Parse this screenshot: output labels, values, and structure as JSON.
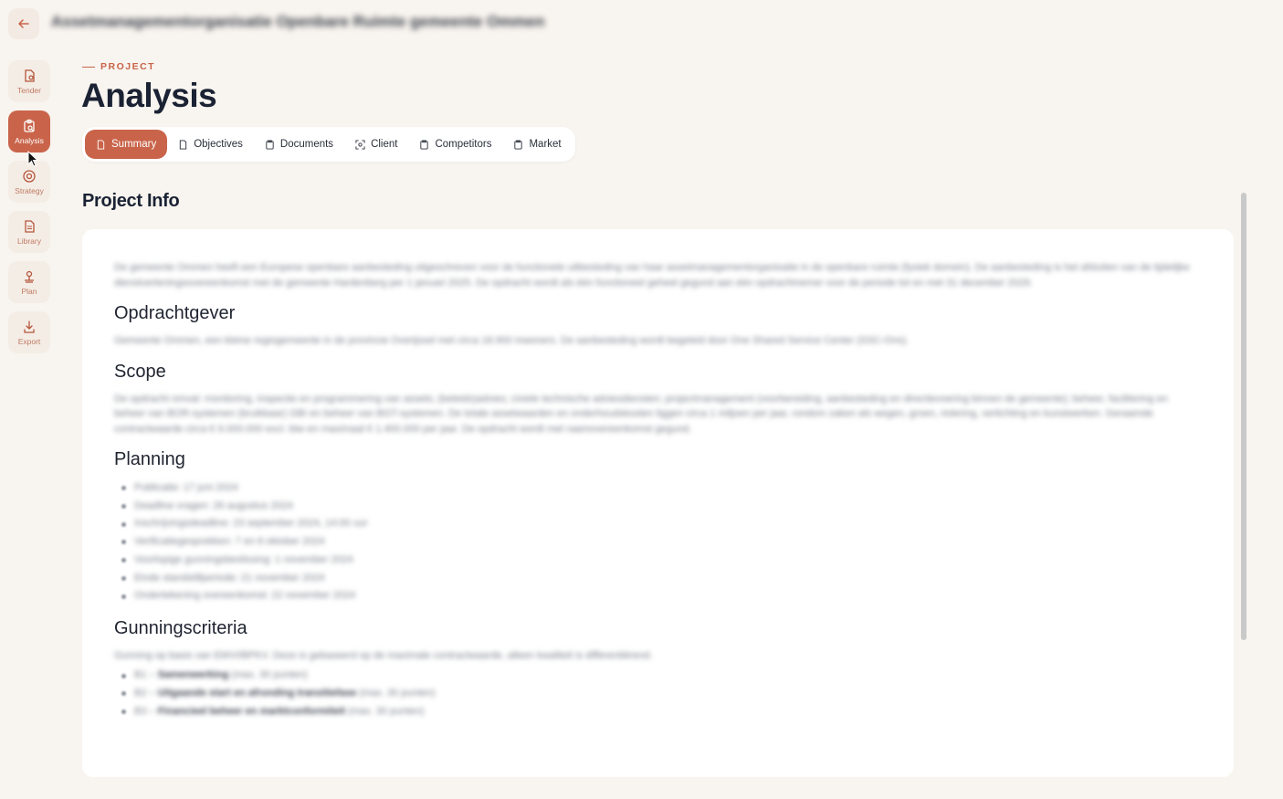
{
  "header": {
    "back_label": "Back",
    "org_title": "Assetmanagementorganisatie Openbare Ruimte gemeente Ommen"
  },
  "sidebar": {
    "items": [
      {
        "label": "Tender",
        "icon": "tender-icon",
        "active": false
      },
      {
        "label": "Analysis",
        "icon": "analysis-icon",
        "active": true
      },
      {
        "label": "Strategy",
        "icon": "strategy-icon",
        "active": false
      },
      {
        "label": "Library",
        "icon": "library-icon",
        "active": false
      },
      {
        "label": "Plan",
        "icon": "plan-icon",
        "active": false
      },
      {
        "label": "Export",
        "icon": "export-icon",
        "active": false
      }
    ]
  },
  "page": {
    "eyebrow": "PROJECT",
    "title": "Analysis"
  },
  "tabs": [
    {
      "label": "Summary",
      "active": true
    },
    {
      "label": "Objectives",
      "active": false
    },
    {
      "label": "Documents",
      "active": false
    },
    {
      "label": "Client",
      "active": false
    },
    {
      "label": "Competitors",
      "active": false
    },
    {
      "label": "Market",
      "active": false
    }
  ],
  "section": {
    "title": "Project Info"
  },
  "content": {
    "intro": "De gemeente Ommen heeft een Europese openbare aanbesteding uitgeschreven voor de functionele uitbesteding van haar assetmanagementorganisatie in de openbare ruimte (fysiek domein). De aanbesteding is het afsluiten van de tijdelijke dienstverleningsovereenkomst met de gemeente Hardenberg per 1 januari 2025. De opdracht wordt als één functioneel geheel gegund aan één opdrachtnemer voor de periode tot en met 31 december 2029.",
    "client_heading": "Opdrachtgever",
    "client_text": "Gemeente Ommen, een kleine regiogemeente in de provincie Overijssel met circa 18.900 inwoners. De aanbesteding wordt begeleid door One Shared Service Center (SSC-Ons).",
    "scope_heading": "Scope",
    "scope_text": "De opdracht omvat: monitoring, inspectie en programmering van assets; (beleids)advies; civiele technische adviesdiensten; projectmanagement (voorbereiding, aanbesteding en directievoering binnen de gemeente); beheer, facilitering en beheer van BOR-systemen (bruikbaar) GBI en beheer van BGT-systemen. De totale assetwaarden en onderhoudskosten liggen circa 1 miljoen per jaar, rondom zaken als wegen, groen, riolering, verlichting en kunstwerken. Geraamde contractwaarde circa € 6.000.000 excl. btw en maximaal € 1.400.000 per jaar. De opdracht wordt met raamovereenkomst gegund.",
    "planning_heading": "Planning",
    "planning_items": [
      "Publicatie: 17 juni 2024",
      "Deadline vragen: 26 augustus 2024",
      "Inschrijvingsdeadline: 23 september 2024, 14:00 uur",
      "Verificatiegesprekken: 7 en 8 oktober 2024",
      "Voorlopige gunningsbeslissing: 1 november 2024",
      "Einde standstillperiode: 21 november 2024",
      "Ondertekening overeenkomst: 22 november 2024"
    ],
    "criteria_heading": "Gunningscriteria",
    "criteria_text": "Gunning op basis van EMVI/BPKV. Deze is gebaseerd op de maximale contractwaarde, alleen kwaliteit is differentiërend.",
    "criteria_items": [
      {
        "code": "B1 –",
        "name": "Samenwerking",
        "points": "(max. 30 punten)"
      },
      {
        "code": "B2 –",
        "name": "Uitgaande start en afronding transitiefase",
        "points": "(max. 30 punten)"
      },
      {
        "code": "B3 –",
        "name": "Financieel beheer en marktconformiteit",
        "points": "(max. 30 punten)"
      }
    ]
  },
  "colors": {
    "accent": "#c9644a",
    "background": "#f8f4ef",
    "card": "#ffffff",
    "title": "#1a2233"
  }
}
